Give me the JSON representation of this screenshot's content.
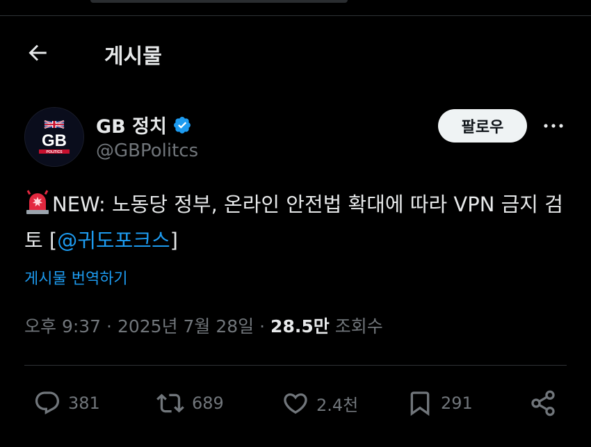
{
  "header": {
    "title": "게시물"
  },
  "author": {
    "name": "GB 정치",
    "handle": "@GBPolitcs",
    "avatar_text": "GB",
    "avatar_subtext": "POLITICS",
    "verified_color": "#1d9bf0"
  },
  "follow_label": "팔로우",
  "tweet": {
    "body_text": "NEW: 노동당 정부, 온라인 안전법 확대에 따라 VPN 금지 검토 [",
    "mention": "@귀도포크스",
    "closing": "]"
  },
  "translate_label": "게시물 번역하기",
  "meta": {
    "time": "오후 9:37",
    "date": "2025년 7월 28일",
    "views_count": "28.5만",
    "views_label": "조회수"
  },
  "actions": {
    "replies": "381",
    "reposts": "689",
    "likes": "2.4천",
    "bookmarks": "291"
  },
  "colors": {
    "background": "#000000",
    "accent": "#1d9bf0",
    "muted": "#71767b",
    "text": "#e7e9ea"
  }
}
